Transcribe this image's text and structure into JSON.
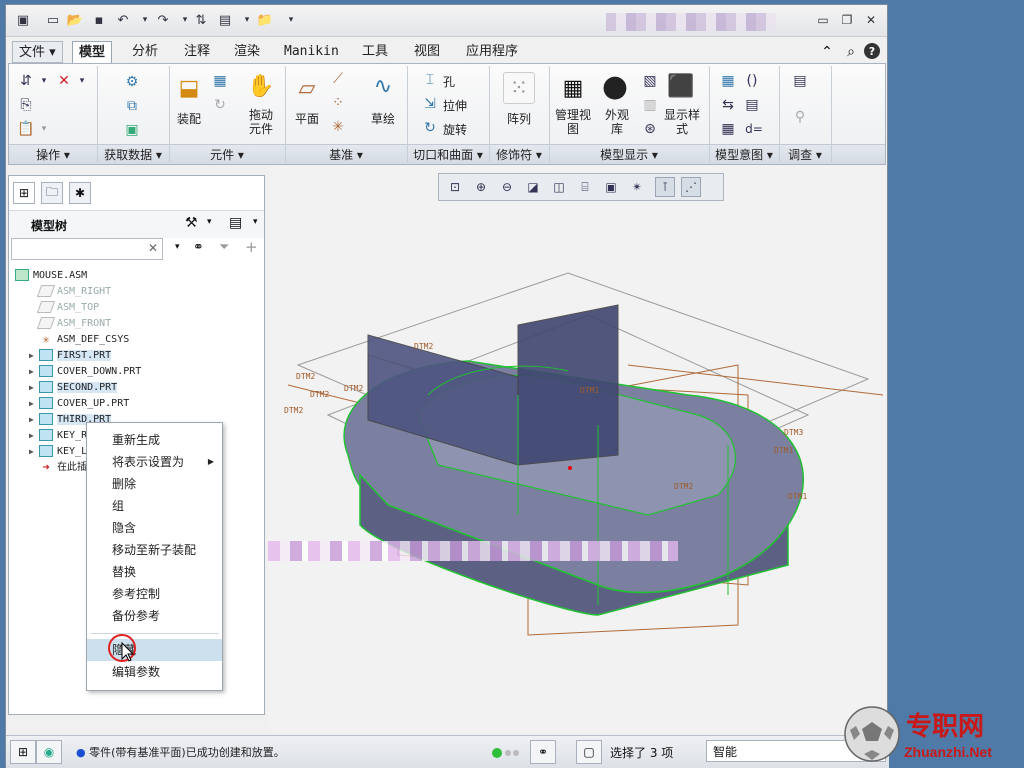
{
  "tabs": [
    "文件",
    "模型",
    "分析",
    "注释",
    "渲染",
    "Manikin",
    "工具",
    "视图",
    "应用程序"
  ],
  "ribbon": {
    "groups": [
      "操作",
      "获取数据",
      "元件",
      "基准",
      "切口和曲面",
      "修饰符",
      "模型显示",
      "模型意图",
      "调查"
    ],
    "buttons": {
      "assemble": "装配",
      "drag": "拖动\n元件",
      "plane": "平面",
      "sketch": "草绘",
      "hole": "孔",
      "extrude": "拉伸",
      "revolve": "旋转",
      "pattern": "阵列",
      "manage_view": "管理视\n图",
      "appearance": "外观\n库",
      "display_style": "显示样\n式"
    }
  },
  "tree": {
    "title": "模型树",
    "rows": [
      {
        "label": "MOUSE.ASM",
        "type": "asm",
        "state": "normal"
      },
      {
        "label": "ASM_RIGHT",
        "type": "plane",
        "state": "gray"
      },
      {
        "label": "ASM_TOP",
        "type": "plane",
        "state": "gray"
      },
      {
        "label": "ASM_FRONT",
        "type": "plane",
        "state": "gray"
      },
      {
        "label": "ASM_DEF_CSYS",
        "type": "csys",
        "state": "normal"
      },
      {
        "label": "FIRST.PRT",
        "type": "part",
        "state": "hl"
      },
      {
        "label": "COVER_DOWN.PRT",
        "type": "part",
        "state": "normal"
      },
      {
        "label": "SECOND.PRT",
        "type": "part",
        "state": "hl"
      },
      {
        "label": "COVER_UP.PRT",
        "type": "part",
        "state": "normal"
      },
      {
        "label": "THIRD.PRT",
        "type": "part",
        "state": "hl"
      },
      {
        "label": "KEY_R",
        "type": "part",
        "state": "normal"
      },
      {
        "label": "KEY_L",
        "type": "part",
        "state": "normal"
      },
      {
        "label": "在此插",
        "type": "insert",
        "state": "normal"
      }
    ]
  },
  "context_menu": {
    "items": [
      "重新生成",
      "将表示设置为",
      "删除",
      "组",
      "隐含",
      "移动至新子装配",
      "替换",
      "参考控制",
      "备份参考",
      "隐藏",
      "编辑参数"
    ],
    "selected": "隐藏"
  },
  "datum_labels": [
    "DTM2",
    "DTM2",
    "DTM2",
    "DTM2",
    "DTM2",
    "DTM1",
    "DTM3",
    "DTM1",
    "DTM2",
    "DTM1"
  ],
  "status": {
    "message": "零件(带有基准平面)已成功创建和放置。",
    "selection": "选择了 3 项",
    "filter": "智能"
  },
  "watermark": {
    "cn": "专职网",
    "url": "Zhuanzhi.Net"
  },
  "colors": {
    "accent": "#4f7aa7",
    "model_edge": "#22c033",
    "datum": "#b06a3a",
    "model_body": "#6f7595"
  }
}
